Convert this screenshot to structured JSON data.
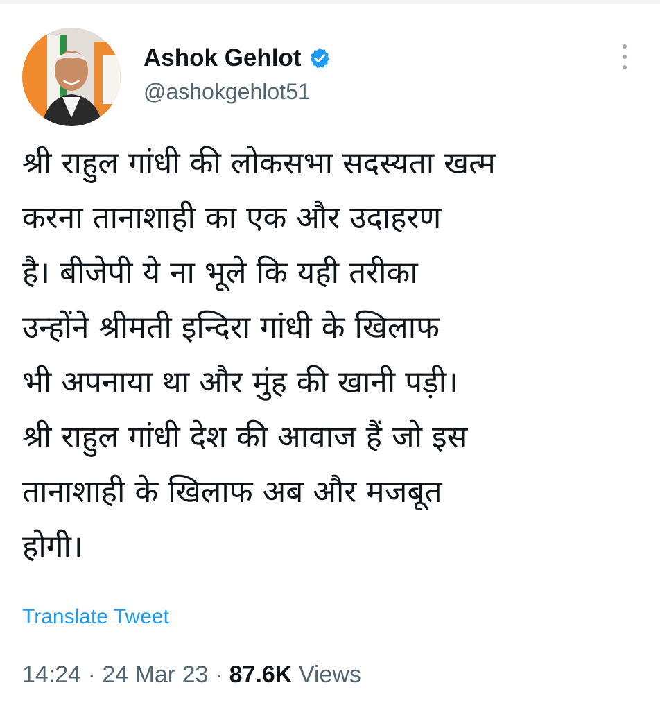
{
  "author": {
    "display_name": "Ashok Gehlot",
    "handle": "@ashokgehlot51",
    "verified": true,
    "avatar_icon": "profile-photo"
  },
  "menu_icon": "more-vertical-icon",
  "tweet": {
    "lines": [
      "श्री राहुल गांधी की लोकसभा सदस्यता खत्म",
      "करना तानाशाही का एक और उदाहरण",
      "है। बीजेपी ये ना भूले कि यही तरीका",
      "उन्होंने श्रीमती इन्दिरा गांधी के खिलाफ",
      "भी अपनाया था और मुंह की खानी पड़ी।",
      "श्री राहुल गांधी देश की आवाज हैं जो इस",
      "तानाशाही के खिलाफ अब और मजबूत",
      "होगी।"
    ]
  },
  "translate_label": "Translate Tweet",
  "meta": {
    "time": "14:24",
    "separator": " · ",
    "date": "24 Mar 23",
    "views_count": "87.6K",
    "views_label": "Views"
  },
  "colors": {
    "link": "#1d9bf0",
    "verified_badge": "#1d9bf0",
    "secondary_text": "#536471",
    "primary_text": "#0f1419"
  }
}
